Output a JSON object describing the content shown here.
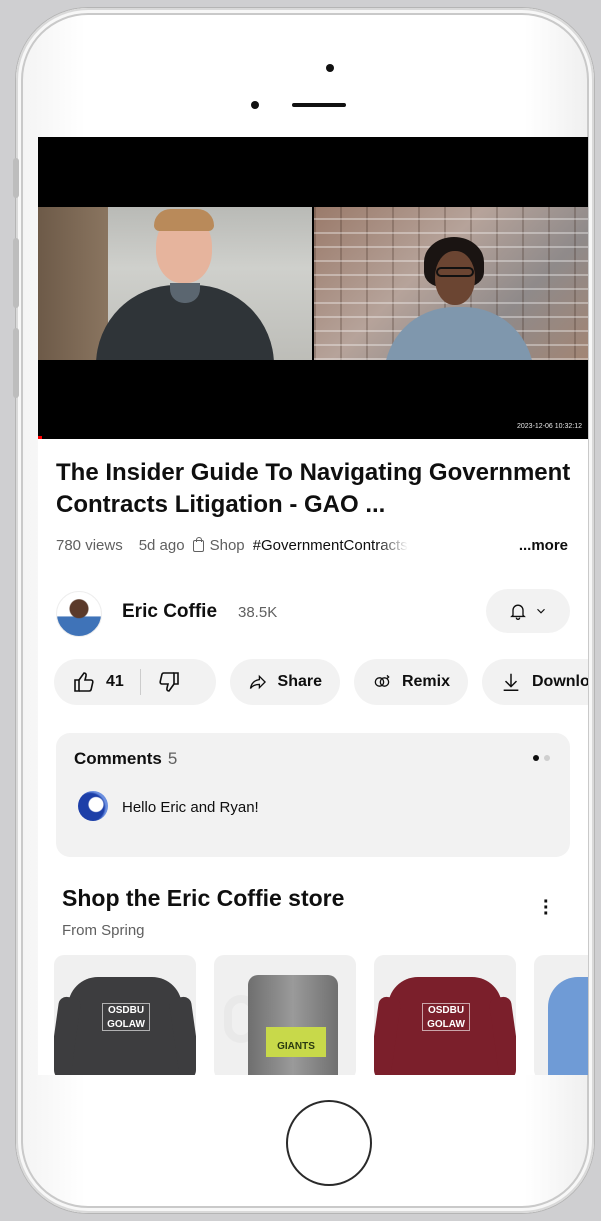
{
  "video": {
    "timestamp": "2023-12-06 10:32:12"
  },
  "title": "The Insider Guide To Navigating Government Contracts Litigation - GAO ...",
  "meta": {
    "views": "780 views",
    "age": "5d ago",
    "shop_label": "Shop",
    "hashtag": "#GovernmentContracts",
    "more_label": "...more"
  },
  "channel": {
    "name": "Eric Coffie",
    "subscribers": "38.5K",
    "bell_chevron": "⌄"
  },
  "actions": {
    "likes": "41",
    "share": "Share",
    "remix": "Remix",
    "download": "Download"
  },
  "comments": {
    "label": "Comments",
    "count": "5",
    "top_comment": "Hello Eric and Ryan!"
  },
  "shop": {
    "title": "Shop the Eric Coffie  store",
    "subtitle": "From Spring",
    "products": [
      {
        "print": "OSDBU GOLAW",
        "color": "#3d3d3f"
      },
      {
        "print": "GIANTS",
        "color": "#8a8a8a"
      },
      {
        "print": "OSDBU GOLAW",
        "color": "#7b1f2b"
      },
      {
        "print": "",
        "color": "#6f9bd6"
      }
    ]
  },
  "colors": {
    "progress": "#ff0000",
    "text_primary": "#0f0f0f",
    "text_secondary": "#606060",
    "pill_bg": "#f2f2f2"
  }
}
